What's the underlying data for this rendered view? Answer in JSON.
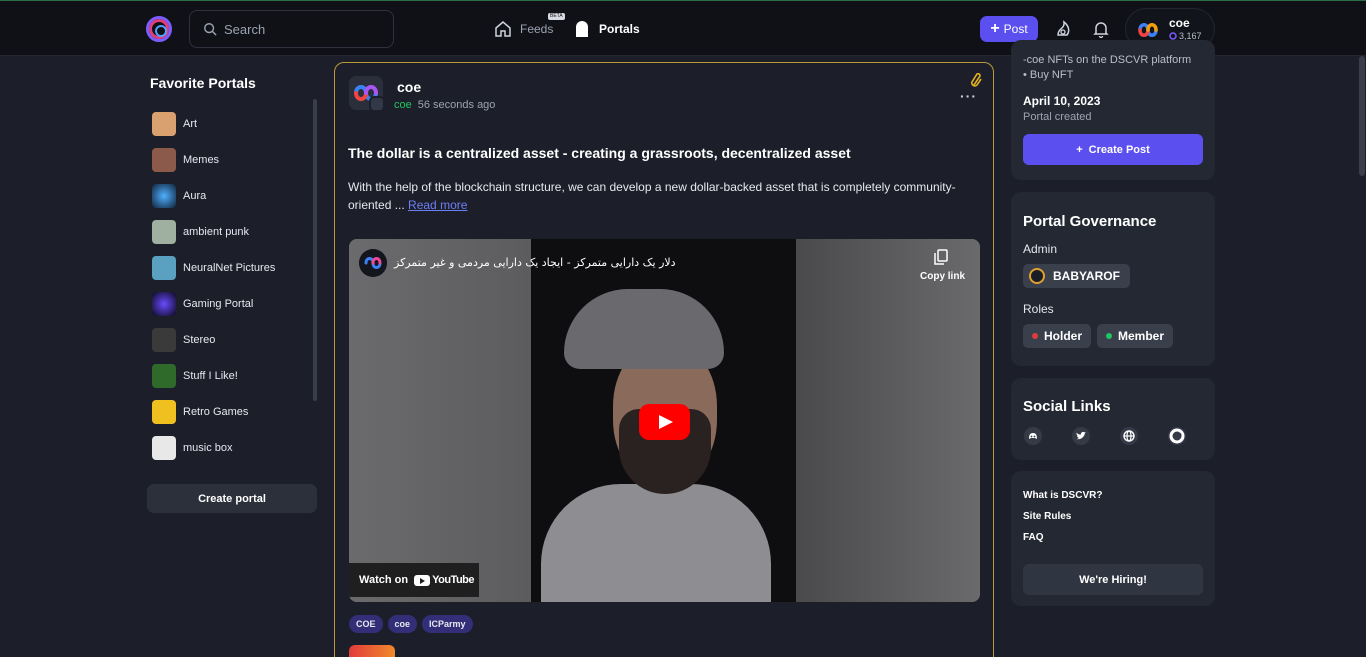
{
  "topnav": {
    "search_placeholder": "Search",
    "feeds_label": "Feeds",
    "feeds_badge": "BETA",
    "portals_label": "Portals",
    "post_label": "Post",
    "user": {
      "name": "coe",
      "points": "3,167"
    }
  },
  "sidebar": {
    "title": "Favorite Portals",
    "items": [
      {
        "label": "Art",
        "color": "#d9a070"
      },
      {
        "label": "Memes",
        "color": "#8b5a4a"
      },
      {
        "label": "Aura",
        "color": "#2a6fa8"
      },
      {
        "label": "ambient punk",
        "color": "#9fb0a0"
      },
      {
        "label": "NeuralNet Pictures",
        "color": "#5aa0c0"
      },
      {
        "label": "Gaming Portal",
        "color": "#1a1a3a"
      },
      {
        "label": "Stereo",
        "color": "#3a3a3a"
      },
      {
        "label": "Stuff I Like!",
        "color": "#2f6a2a"
      },
      {
        "label": "Retro Games",
        "color": "#f0c020"
      },
      {
        "label": "music box",
        "color": "#e8e8e8"
      }
    ],
    "create_portal": "Create portal"
  },
  "post": {
    "author": "coe",
    "portal": "coe",
    "time": "56 seconds ago",
    "title": "The dollar is a centralized asset - creating a grassroots, decentralized asset",
    "body": "With the help of the blockchain structure, we can develop a new dollar-backed asset that is completely community-oriented ...",
    "read_more": "Read more",
    "video": {
      "title": "دلار یک دارایی متمرکز - ایجاد یک دارایی مردمی و غیر متمرکز",
      "copy_link": "Copy link",
      "watch_on": "Watch on",
      "youtube": "YouTube"
    },
    "tags": [
      "COE",
      "coe",
      "ICParmy"
    ]
  },
  "about": {
    "line1": "-coe NFTs on the DSCVR platform",
    "line2": "• Buy NFT",
    "date": "April 10, 2023",
    "created": "Portal created",
    "create_post": "Create Post"
  },
  "governance": {
    "title": "Portal Governance",
    "admin_label": "Admin",
    "admin_name": "BABYAROF",
    "roles_label": "Roles",
    "roles": [
      {
        "label": "Holder",
        "color": "#e23b3b"
      },
      {
        "label": "Member",
        "color": "#22c55e"
      }
    ]
  },
  "social": {
    "title": "Social Links",
    "icons": [
      "discord-icon",
      "twitter-icon",
      "globe-icon",
      "dscvr-icon"
    ]
  },
  "links": {
    "items": [
      "What is DSCVR?",
      "Site Rules",
      "FAQ"
    ],
    "hiring": "We're Hiring!"
  },
  "colors": {
    "accent": "#5b4ff0",
    "bg": "#1c1f2a",
    "card": "#242833",
    "nav": "#0f1117",
    "pinned_border": "#b89a3a"
  }
}
